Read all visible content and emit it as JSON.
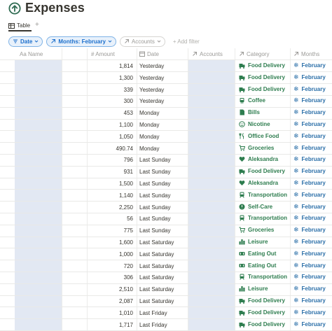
{
  "page": {
    "title": "Expenses"
  },
  "view": {
    "tab": "Table",
    "add": "+"
  },
  "filters": [
    {
      "label": "Date",
      "kind": "active",
      "icon": "sort-icon",
      "caret": true
    },
    {
      "label": "Months: February",
      "kind": "active",
      "icon": "arrow-up-right-icon",
      "caret": true
    },
    {
      "label": "Accounts",
      "kind": "plain",
      "icon": "arrow-up-right-icon",
      "caret": true
    },
    {
      "label": "+ Add filter",
      "kind": "ghost"
    }
  ],
  "columns": {
    "name": "Aa Name",
    "amount": "# Amount",
    "date": "Date",
    "accounts": "Accounts",
    "category": "Category",
    "months": "Months"
  },
  "rows": [
    {
      "amount": "1,814",
      "date": "Yesterday",
      "category": "Food Delivery",
      "icon": "food-delivery-icon",
      "month": "February"
    },
    {
      "amount": "1,300",
      "date": "Yesterday",
      "category": "Food Delivery",
      "icon": "food-delivery-icon",
      "month": "February"
    },
    {
      "amount": "339",
      "date": "Yesterday",
      "category": "Food Delivery",
      "icon": "food-delivery-icon",
      "month": "February"
    },
    {
      "amount": "300",
      "date": "Yesterday",
      "category": "Coffee",
      "icon": "coffee-icon",
      "month": "February"
    },
    {
      "amount": "453",
      "date": "Monday",
      "category": "Bills",
      "icon": "bills-icon",
      "month": "February"
    },
    {
      "amount": "1,100",
      "date": "Monday",
      "category": "Nicotine",
      "icon": "nicotine-icon",
      "month": "February"
    },
    {
      "amount": "1,050",
      "date": "Monday",
      "category": "Office Food",
      "icon": "office-food-icon",
      "month": "February"
    },
    {
      "amount": "490.74",
      "date": "Monday",
      "category": "Groceries",
      "icon": "cart-icon",
      "month": "February"
    },
    {
      "amount": "796",
      "date": "Last Sunday",
      "category": "Aleksandra",
      "icon": "heart-icon",
      "month": "February"
    },
    {
      "amount": "931",
      "date": "Last Sunday",
      "category": "Food Delivery",
      "icon": "food-delivery-icon",
      "month": "February"
    },
    {
      "amount": "1,500",
      "date": "Last Sunday",
      "category": "Aleksandra",
      "icon": "heart-icon",
      "month": "February"
    },
    {
      "amount": "1,140",
      "date": "Last Sunday",
      "category": "Transportation",
      "icon": "transport-icon",
      "month": "February"
    },
    {
      "amount": "2,250",
      "date": "Last Sunday",
      "category": "Self-Care",
      "icon": "self-care-icon",
      "month": "February"
    },
    {
      "amount": "56",
      "date": "Last Sunday",
      "category": "Transportation",
      "icon": "transport-icon",
      "month": "February"
    },
    {
      "amount": "775",
      "date": "Last Sunday",
      "category": "Groceries",
      "icon": "cart-icon",
      "month": "February"
    },
    {
      "amount": "1,600",
      "date": "Last Saturday",
      "category": "Leisure",
      "icon": "leisure-icon",
      "month": "February"
    },
    {
      "amount": "1,000",
      "date": "Last Saturday",
      "category": "Eating Out",
      "icon": "eating-out-icon",
      "month": "February"
    },
    {
      "amount": "720",
      "date": "Last Saturday",
      "category": "Eating Out",
      "icon": "eating-out-icon",
      "month": "February"
    },
    {
      "amount": "306",
      "date": "Last Saturday",
      "category": "Transportation",
      "icon": "transport-icon",
      "month": "February"
    },
    {
      "amount": "2,510",
      "date": "Last Saturday",
      "category": "Leisure",
      "icon": "leisure-icon",
      "month": "February"
    },
    {
      "amount": "2,087",
      "date": "Last Saturday",
      "category": "Food Delivery",
      "icon": "food-delivery-icon",
      "month": "February"
    },
    {
      "amount": "1,010",
      "date": "Last Friday",
      "category": "Food Delivery",
      "icon": "food-delivery-icon",
      "month": "February"
    },
    {
      "amount": "1,717",
      "date": "Last Friday",
      "category": "Food Delivery",
      "icon": "food-delivery-icon",
      "month": "February"
    }
  ],
  "colors": {
    "accent": "#1c6fcc",
    "category": "#2e7d4f",
    "month": "#2b6fa8",
    "band": "#e2e8f3"
  }
}
